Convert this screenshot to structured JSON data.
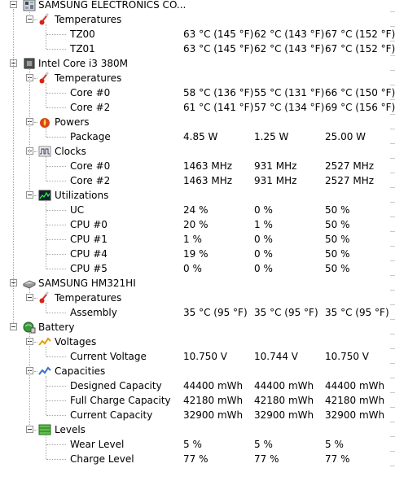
{
  "devices": [
    {
      "name": "SAMSUNG ELECTRONICS CO...",
      "icon": "motherboard-icon",
      "groups": [
        {
          "name": "Temperatures",
          "icon": "thermometer-icon",
          "rows": [
            {
              "label": "TZ00",
              "value": "63 °C  (145 °F)",
              "min": "62 °C  (143 °F)",
              "max": "67 °C  (152 °F)"
            },
            {
              "label": "TZ01",
              "value": "63 °C  (145 °F)",
              "min": "62 °C  (143 °F)",
              "max": "67 °C  (152 °F)"
            }
          ]
        }
      ]
    },
    {
      "name": "Intel Core i3 380M",
      "icon": "cpu-chip-icon",
      "groups": [
        {
          "name": "Temperatures",
          "icon": "thermometer-icon",
          "rows": [
            {
              "label": "Core #0",
              "value": "58 °C  (136 °F)",
              "min": "55 °C  (131 °F)",
              "max": "66 °C  (150 °F)"
            },
            {
              "label": "Core #2",
              "value": "61 °C  (141 °F)",
              "min": "57 °C  (134 °F)",
              "max": "69 °C  (156 °F)"
            }
          ]
        },
        {
          "name": "Powers",
          "icon": "power-flame-icon",
          "rows": [
            {
              "label": "Package",
              "value": "4.85 W",
              "min": "1.25 W",
              "max": "25.00 W"
            }
          ]
        },
        {
          "name": "Clocks",
          "icon": "clock-wave-icon",
          "rows": [
            {
              "label": "Core #0",
              "value": "1463 MHz",
              "min": "931 MHz",
              "max": "2527 MHz"
            },
            {
              "label": "Core #2",
              "value": "1463 MHz",
              "min": "931 MHz",
              "max": "2527 MHz"
            }
          ]
        },
        {
          "name": "Utilizations",
          "icon": "utilization-graph-icon",
          "rows": [
            {
              "label": "UC",
              "value": "24 %",
              "min": "0 %",
              "max": "50 %"
            },
            {
              "label": "CPU #0",
              "value": "20 %",
              "min": "1 %",
              "max": "50 %"
            },
            {
              "label": "CPU #1",
              "value": "1 %",
              "min": "0 %",
              "max": "50 %"
            },
            {
              "label": "CPU #4",
              "value": "19 %",
              "min": "0 %",
              "max": "50 %"
            },
            {
              "label": "CPU #5",
              "value": "0 %",
              "min": "0 %",
              "max": "50 %"
            }
          ]
        }
      ]
    },
    {
      "name": "SAMSUNG HM321HI",
      "icon": "hard-disk-icon",
      "groups": [
        {
          "name": "Temperatures",
          "icon": "thermometer-icon",
          "rows": [
            {
              "label": "Assembly",
              "value": "35 °C  (95 °F)",
              "min": "35 °C  (95 °F)",
              "max": "35 °C  (95 °F)"
            }
          ]
        }
      ]
    },
    {
      "name": "Battery",
      "icon": "battery-icon",
      "groups": [
        {
          "name": "Voltages",
          "icon": "voltage-graph-icon",
          "rows": [
            {
              "label": "Current Voltage",
              "value": "10.750 V",
              "min": "10.744 V",
              "max": "10.750 V"
            }
          ]
        },
        {
          "name": "Capacities",
          "icon": "capacity-graph-icon",
          "rows": [
            {
              "label": "Designed Capacity",
              "value": "44400 mWh",
              "min": "44400 mWh",
              "max": "44400 mWh"
            },
            {
              "label": "Full Charge Capacity",
              "value": "42180 mWh",
              "min": "42180 mWh",
              "max": "42180 mWh"
            },
            {
              "label": "Current Capacity",
              "value": "32900 mWh",
              "min": "32900 mWh",
              "max": "32900 mWh"
            }
          ]
        },
        {
          "name": "Levels",
          "icon": "levels-bar-icon",
          "rows": [
            {
              "label": "Wear Level",
              "value": "5 %",
              "min": "5 %",
              "max": "5 %"
            },
            {
              "label": "Charge Level",
              "value": "77 %",
              "min": "77 %",
              "max": "77 %"
            }
          ]
        }
      ]
    }
  ]
}
